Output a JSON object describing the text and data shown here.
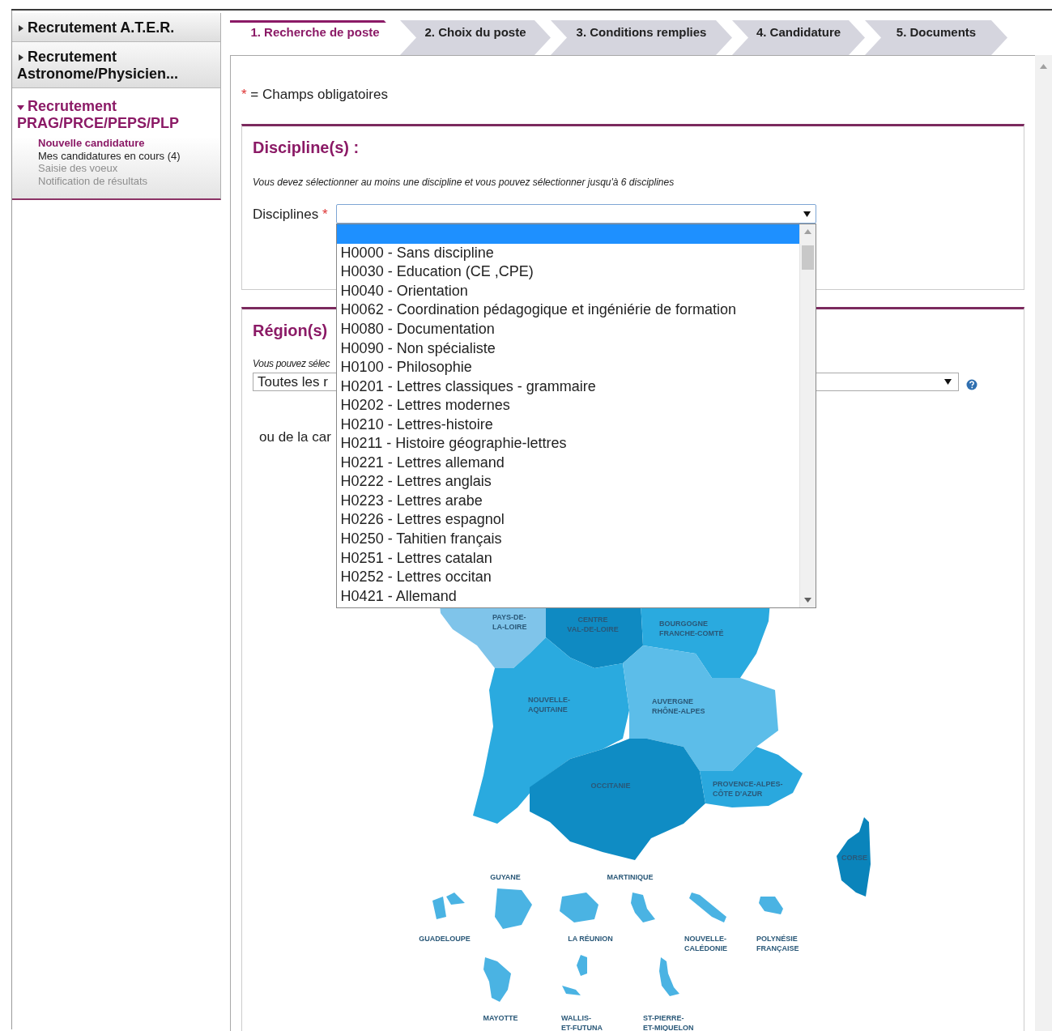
{
  "sidebar": {
    "items": [
      {
        "label": "Recrutement A.T.E.R.",
        "expanded": false
      },
      {
        "label": "Recrutement Astronome/Physicien...",
        "expanded": false
      },
      {
        "label": "Recrutement PRAG/PRCE/PEPS/PLP",
        "expanded": true,
        "children": [
          {
            "label": "Nouvelle candidature",
            "selected": true,
            "disabled": false
          },
          {
            "label": "Mes candidatures en cours (4)",
            "selected": false,
            "disabled": false
          },
          {
            "label": "Saisie des voeux",
            "selected": false,
            "disabled": true
          },
          {
            "label": "Notification de résultats",
            "selected": false,
            "disabled": true
          }
        ]
      }
    ]
  },
  "tabs": [
    {
      "label": "1. Recherche de poste",
      "selected": true
    },
    {
      "label": "2. Choix du poste",
      "selected": false
    },
    {
      "label": "3. Conditions remplies",
      "selected": false
    },
    {
      "label": "4. Candidature",
      "selected": false
    },
    {
      "label": "5. Documents",
      "selected": false
    }
  ],
  "required_note": {
    "mark": "*",
    "text": "= Champs obligatoires"
  },
  "discipline_section": {
    "title": "Discipline(s) :",
    "hint": "Vous devez sélectionner au moins une discipline et vous pouvez sélectionner jusqu'à 6 disciplines",
    "field": {
      "label": "Disciplines",
      "required_mark": "*",
      "expanded": true,
      "options": [
        {
          "selected": true
        },
        {
          "label": "H0000 - Sans discipline",
          "selected": false
        },
        {
          "label": "H0030 - Education (CE ,CPE)",
          "selected": false
        },
        {
          "label": "H0040 - Orientation",
          "selected": false
        },
        {
          "label": "H0062 - Coordination pédagogique et ingéniérie de formation",
          "selected": false
        },
        {
          "label": "H0080 - Documentation",
          "selected": false
        },
        {
          "label": "H0090 - Non spécialiste",
          "selected": false
        },
        {
          "label": "H0100 - Philosophie",
          "selected": false
        },
        {
          "label": "H0201 - Lettres classiques - grammaire",
          "selected": false
        },
        {
          "label": "H0202 - Lettres modernes",
          "selected": false
        },
        {
          "label": "H0210 - Lettres-histoire",
          "selected": false
        },
        {
          "label": "H0211 - Histoire géographie-lettres",
          "selected": false
        },
        {
          "label": "H0221 - Lettres allemand",
          "selected": false
        },
        {
          "label": "H0222 - Lettres anglais",
          "selected": false
        },
        {
          "label": "H0223 - Lettres arabe",
          "selected": false
        },
        {
          "label": "H0226 - Lettres espagnol",
          "selected": false
        },
        {
          "label": "H0250 - Tahitien français",
          "selected": false
        },
        {
          "label": "H0251 - Lettres catalan",
          "selected": false
        },
        {
          "label": "H0252 - Lettres occitan",
          "selected": false
        },
        {
          "label": "H0421 - Allemand",
          "selected": false
        }
      ]
    }
  },
  "region_section": {
    "title": "Région(s)",
    "hint": "Vous pouvez sélec",
    "select": {
      "value": "Toutes les r"
    },
    "map_caption": "ou de la car",
    "map": {
      "regions": [
        {
          "lines": [
            "PAYS-DE-",
            "LA-LOIRE"
          ],
          "color": "#7fc4ea"
        },
        {
          "lines": [
            "CENTRE",
            "VAL-DE-LOIRE"
          ],
          "color": "#0f8ac2"
        },
        {
          "lines": [
            "BOURGOGNE",
            "FRANCHE-COMTÉ"
          ],
          "color": "#2aaadf"
        },
        {
          "lines": [
            "NOUVELLE-",
            "AQUITAINE"
          ],
          "color": "#2aaadf"
        },
        {
          "lines": [
            "AUVERGNE",
            "RHÔNE-ALPES"
          ],
          "color": "#5cbde9"
        },
        {
          "lines": [
            "OCCITANIE"
          ],
          "color": "#0f8cc4"
        },
        {
          "lines": [
            "PROVENCE-ALPES-",
            "CÔTE D'AZUR"
          ],
          "color": "#2aa8de"
        },
        {
          "lines": [
            "CORSE"
          ],
          "color": "#0a84bb"
        },
        {
          "lines": [
            "GUYANE"
          ],
          "color": "#4ab3e3"
        },
        {
          "lines": [
            "MARTINIQUE"
          ],
          "color": "#4ab3e3"
        },
        {
          "lines": [
            "GUADELOUPE"
          ],
          "color": "#4ab3e3"
        },
        {
          "lines": [
            "LA RÉUNION"
          ],
          "color": "#4ab3e3"
        },
        {
          "lines": [
            "NOUVELLE-",
            "CALÉDONIE"
          ],
          "color": "#4ab3e3"
        },
        {
          "lines": [
            "POLYNÉSIE",
            "FRANÇAISE"
          ],
          "color": "#4ab3e3"
        },
        {
          "lines": [
            "MAYOTTE"
          ],
          "color": "#4ab3e3"
        },
        {
          "lines": [
            "WALLIS-",
            "ET-FUTUNA"
          ],
          "color": "#4ab3e3"
        },
        {
          "lines": [
            "ST-PIERRE-",
            "ET-MIQUELON"
          ],
          "color": "#4ab3e3"
        }
      ]
    }
  }
}
